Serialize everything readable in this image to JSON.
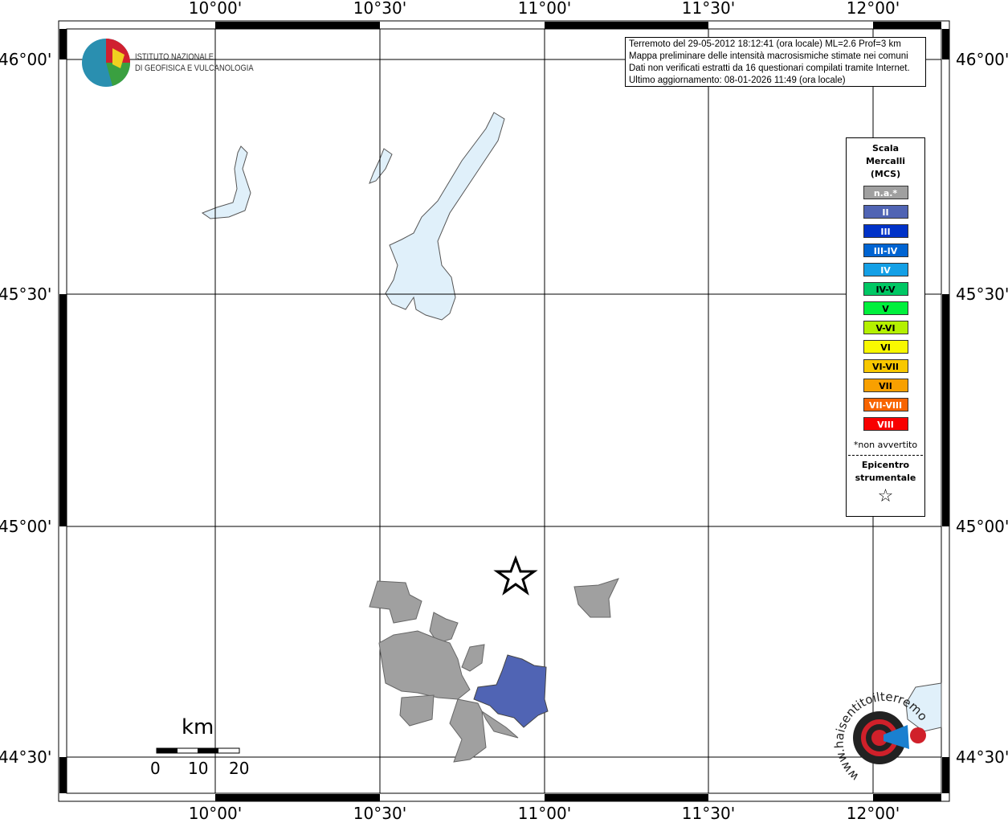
{
  "axes": {
    "lon_labels": [
      "10°00'",
      "10°30'",
      "11°00'",
      "11°30'",
      "12°00'"
    ],
    "lat_labels": [
      "46°00'",
      "45°30'",
      "45°00'",
      "44°30'"
    ]
  },
  "logo": {
    "line1": "ISTITUTO NAZIONALE",
    "line2": "DI GEOFISICA E VULCANOLOGIA"
  },
  "info": {
    "lines": [
      "Terremoto del 29-05-2012 18:12:41 (ora locale) ML=2.6 Prof=3 km",
      "Mappa preliminare delle intensità macrosismiche stimate nei comuni",
      "Dati non verificati estratti da 16 questionari compilati tramite Internet.",
      "Ultimo aggiornamento: 08-01-2026 11:49 (ora locale)"
    ]
  },
  "legend": {
    "title": [
      "Scala",
      "Mercalli",
      "(MCS)"
    ],
    "items": [
      {
        "label": "n.a.*",
        "color": "#a0a0a0"
      },
      {
        "label": "II",
        "color": "#5064b4"
      },
      {
        "label": "III",
        "color": "#0032c8"
      },
      {
        "label": "III-IV",
        "color": "#0064d2"
      },
      {
        "label": "IV",
        "color": "#14a0e6"
      },
      {
        "label": "IV-V",
        "color": "#00c864"
      },
      {
        "label": "V",
        "color": "#00f03c"
      },
      {
        "label": "V-VI",
        "color": "#b4f000"
      },
      {
        "label": "VI",
        "color": "#f8f800"
      },
      {
        "label": "VI-VII",
        "color": "#f8c800"
      },
      {
        "label": "VII",
        "color": "#f8a000"
      },
      {
        "label": "VII-VIII",
        "color": "#f86400"
      },
      {
        "label": "VIII",
        "color": "#f80000"
      }
    ],
    "note": "*non avvertito",
    "epi_title": [
      "Epicentro",
      "strumentale"
    ],
    "epi_symbol": "☆"
  },
  "scale": {
    "unit": "km",
    "ticks": [
      "0",
      "10",
      "20"
    ]
  },
  "watermark": {
    "text": "www.haisentitoilterremoto.it"
  }
}
